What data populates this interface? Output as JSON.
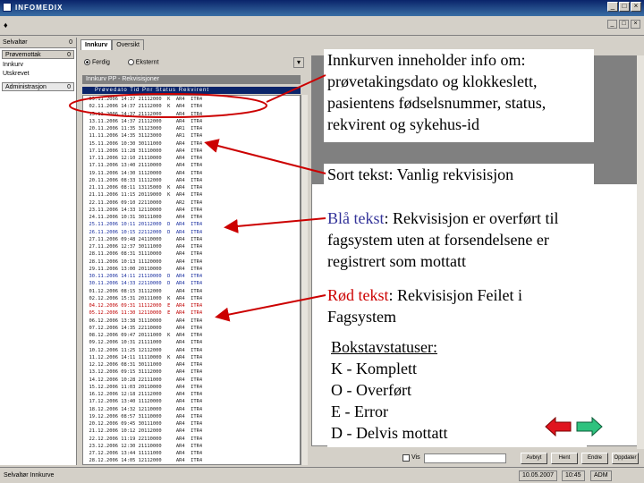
{
  "window": {
    "title": "INFOMEDIX",
    "menu_glyph": "♦"
  },
  "left_panel": {
    "header": "Selvaltør",
    "header_count": "0",
    "items": [
      {
        "label": "Prøvemottak",
        "badge": "0"
      },
      {
        "label": "Innkurv",
        "badge": ""
      },
      {
        "label": "Utskrevet",
        "badge": ""
      },
      {
        "label": "Administrasjon",
        "badge": "0"
      }
    ]
  },
  "main": {
    "tabs": [
      "Innkurv",
      "Oversikt"
    ],
    "radio_options": [
      {
        "label": "Ferdig",
        "selected": true
      },
      {
        "label": "Eksternt",
        "selected": false
      }
    ],
    "grid_caption": "Innkurv PP - Rekvisisjoner",
    "grid_header": "Prøvedato Tid Pnr Status Rekvirent",
    "rows": [
      {
        "text": "09.11.2006 14:37 21112000  K  AR4  ITR4",
        "color": "black"
      },
      {
        "text": "02.11.2006 14:37 21112000  K  AR4  ITR4",
        "color": "black"
      },
      {
        "text": "15.11.2006 14:37 21112000     AR4  ITR4",
        "color": "black"
      },
      {
        "text": "13.11.2006 14:37 21112000     AR4  ITR4",
        "color": "black"
      },
      {
        "text": "20.11.2006 11:35 31123000     AR1  ITR4",
        "color": "black"
      },
      {
        "text": "11.11.2006 14:35 31123000     AR1  ITR4",
        "color": "black"
      },
      {
        "text": "15.11.2006 10:30 30111000     AR4  ITR4",
        "color": "black"
      },
      {
        "text": "17.11.2006 11:28 31110000     AR4  ITR4",
        "color": "black"
      },
      {
        "text": "17.11.2006 12:10 21110000     AR4  ITR4",
        "color": "black"
      },
      {
        "text": "17.11.2006 13:40 21110000     AR4  ITR4",
        "color": "black"
      },
      {
        "text": "19.11.2006 14:30 11120000     AR4  ITR4",
        "color": "black"
      },
      {
        "text": "20.11.2006 08:33 11112000     AR4  ITR4",
        "color": "black"
      },
      {
        "text": "21.11.2006 08:11 13115000  K  AR4  ITR4",
        "color": "black"
      },
      {
        "text": "21.11.2006 11:15 20119000  K  AR4  ITR4",
        "color": "black"
      },
      {
        "text": "22.11.2006 09:10 22110000     AR2  ITR4",
        "color": "black"
      },
      {
        "text": "23.11.2006 14:33 12110000     AR4  ITR4",
        "color": "black"
      },
      {
        "text": "24.11.2006 10:31 30111000     AR4  ITR4",
        "color": "black"
      },
      {
        "text": "25.11.2006 10:11 20112000  D  AR4  ITR4",
        "color": "blue"
      },
      {
        "text": "26.11.2006 10:15 22112000  D  AR4  ITR4",
        "color": "blue"
      },
      {
        "text": "27.11.2006 09:48 24110000     AR4  ITR4",
        "color": "black"
      },
      {
        "text": "27.11.2006 12:37 30111000     AR4  ITR4",
        "color": "black"
      },
      {
        "text": "28.11.2006 08:31 31110000     AR4  ITR4",
        "color": "black"
      },
      {
        "text": "28.11.2006 10:13 11120000     AR4  ITR4",
        "color": "black"
      },
      {
        "text": "29.11.2006 13:00 20110000     AR4  ITR4",
        "color": "black"
      },
      {
        "text": "30.11.2006 14:11 21110000  D  AR4  ITR4",
        "color": "blue"
      },
      {
        "text": "30.11.2006 14:33 22110000  D  AR4  ITR4",
        "color": "blue"
      },
      {
        "text": "01.12.2006 08:15 31112000     AR4  ITR4",
        "color": "black"
      },
      {
        "text": "02.12.2006 15:31 20111000  K  AR4  ITR4",
        "color": "black"
      },
      {
        "text": "04.12.2006 09:31 11112000  E  AR4  ITR4",
        "color": "red"
      },
      {
        "text": "05.12.2006 11:30 12110000  E  AR4  ITR4",
        "color": "red"
      },
      {
        "text": "06.12.2006 13:38 31110000     AR4  ITR4",
        "color": "black"
      },
      {
        "text": "07.12.2006 14:35 22110000     AR4  ITR4",
        "color": "black"
      },
      {
        "text": "08.12.2006 09:47 20111000  K  AR4  ITR4",
        "color": "black"
      },
      {
        "text": "09.12.2006 10:31 21111000     AR4  ITR4",
        "color": "black"
      },
      {
        "text": "10.12.2006 11:25 12112000     AR4  ITR4",
        "color": "black"
      },
      {
        "text": "11.12.2006 14:11 11110000  K  AR4  ITR4",
        "color": "black"
      },
      {
        "text": "12.12.2006 08:31 30111000     AR4  ITR4",
        "color": "black"
      },
      {
        "text": "13.12.2006 09:15 31112000     AR4  ITR4",
        "color": "black"
      },
      {
        "text": "14.12.2006 10:28 22111000     AR4  ITR4",
        "color": "black"
      },
      {
        "text": "15.12.2006 11:03 20110000     AR4  ITR4",
        "color": "black"
      },
      {
        "text": "16.12.2006 12:18 21112000     AR4  ITR4",
        "color": "black"
      },
      {
        "text": "17.12.2006 13:40 11120000     AR4  ITR4",
        "color": "black"
      },
      {
        "text": "18.12.2006 14:32 12110000     AR4  ITR4",
        "color": "black"
      },
      {
        "text": "19.12.2006 08:57 31110000     AR4  ITR4",
        "color": "black"
      },
      {
        "text": "20.12.2006 09:45 30111000     AR4  ITR4",
        "color": "black"
      },
      {
        "text": "21.12.2006 10:12 20112000     AR4  ITR4",
        "color": "black"
      },
      {
        "text": "22.12.2006 11:19 22110000     AR4  ITR4",
        "color": "black"
      },
      {
        "text": "23.12.2006 12:30 21110000     AR4  ITR4",
        "color": "black"
      },
      {
        "text": "27.12.2006 13:44 11111000     AR4  ITR4",
        "color": "black"
      },
      {
        "text": "28.12.2006 14:05 12112000     AR4  ITR4",
        "color": "black"
      }
    ]
  },
  "bottom_toolbar": {
    "checkbox_label": "Vis",
    "buttons": [
      "Avbryt",
      "Hent",
      "Endre",
      "Oppdater"
    ]
  },
  "status_bar": {
    "text": "Selvaltør Innkurve",
    "date": "10.05.2007",
    "time": "10:45",
    "user": "ADM"
  },
  "callouts": {
    "intro": "Innkurven inneholder info om: prøvetakingsdato og klokkeslett, pasientens fødselsnummer, status, rekvirent og sykehus-id",
    "black_text": "Sort tekst: Vanlig rekvisisjon",
    "blue_lead": "Blå tekst",
    "blue_rest": ":  Rekvisisjon er overført til fagsystem uten at forsendelsene er registrert som mottatt",
    "red_lead": "Rød tekst",
    "red_rest": ": Rekvisisjon Feilet i Fagsystem",
    "status_heading": "Bokstavstatuser:",
    "status_lines": [
      "K - Komplett",
      "O - Overført",
      "E - Error",
      "D - Delvis mottatt"
    ]
  },
  "colors": {
    "title_bar": "#0a246a",
    "blue_status": "#1a2fa0",
    "red_status": "#c00000",
    "callout_arrow": "#cc0000",
    "nav_prev": "#e0141e",
    "nav_next": "#2ec27e"
  },
  "icons": {
    "nav_prev": "red-left-arrow-icon",
    "nav_next": "green-right-arrow-icon"
  }
}
